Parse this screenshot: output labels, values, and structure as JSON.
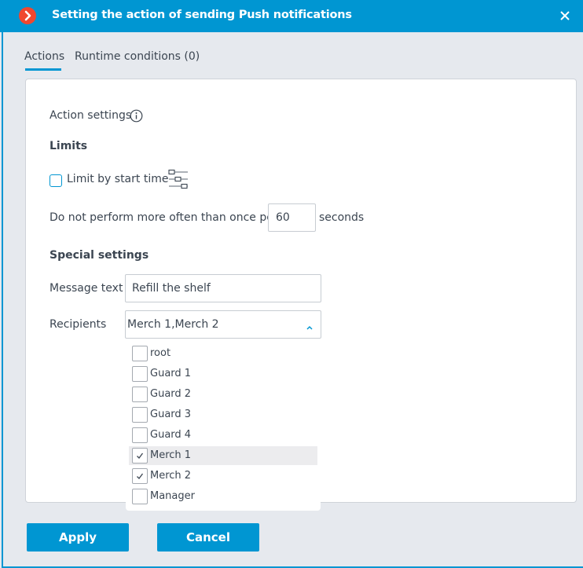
{
  "window": {
    "title": "Setting the action of sending Push notifications",
    "icon": "chevron-right-icon",
    "close_icon": "close-icon"
  },
  "tabs": [
    {
      "label": "Actions",
      "active": true
    },
    {
      "label": "Runtime conditions (0)",
      "active": false
    }
  ],
  "action_settings": {
    "heading": "Action settings",
    "info_icon": "info-icon"
  },
  "limits": {
    "heading": "Limits",
    "limit_by_start_time": {
      "label": "Limit by start time",
      "checked": false
    },
    "frequency": {
      "prefix": "Do not perform more often than once per",
      "value": "60",
      "suffix": "seconds"
    }
  },
  "special_settings": {
    "heading": "Special settings",
    "message_text": {
      "label": "Message text",
      "value": "Refill the shelf"
    },
    "recipients": {
      "label": "Recipients",
      "value": "Merch 1,Merch 2",
      "expanded": true,
      "options": [
        {
          "label": "root",
          "checked": false
        },
        {
          "label": "Guard 1",
          "checked": false
        },
        {
          "label": "Guard 2",
          "checked": false
        },
        {
          "label": "Guard 3",
          "checked": false
        },
        {
          "label": "Guard 4",
          "checked": false
        },
        {
          "label": "Merch 1",
          "checked": true,
          "hovered": true
        },
        {
          "label": "Merch 2",
          "checked": true
        },
        {
          "label": "Manager",
          "checked": false
        }
      ]
    }
  },
  "buttons": {
    "apply": "Apply",
    "cancel": "Cancel"
  },
  "colors": {
    "accent": "#0096d2",
    "title_icon": "#f0472f",
    "background": "#e6e9ee",
    "text": "#3b4551"
  }
}
